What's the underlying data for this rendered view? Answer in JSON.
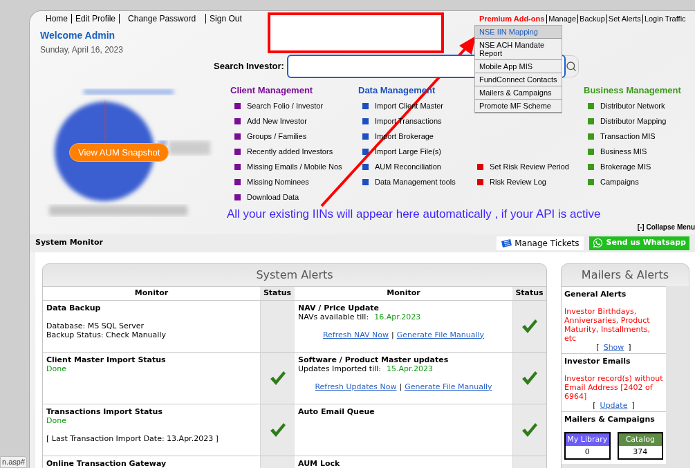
{
  "top_links": [
    "Home",
    "Edit Profile",
    "Change Password",
    "Sign Out"
  ],
  "admin_links": [
    {
      "label": "Premium Add-ons",
      "kind": "premium"
    },
    {
      "label": "Manage",
      "kind": "plain"
    },
    {
      "label": "Backup",
      "kind": "plain"
    },
    {
      "label": "Set Alerts",
      "kind": "plain"
    },
    {
      "label": "Login Traffic",
      "kind": "plain"
    }
  ],
  "premium_menu": [
    {
      "label": "NSE IIN Mapping",
      "selected": true
    },
    {
      "label": "NSE ACH Mandate Report",
      "selected": false
    },
    {
      "label": "Mobile App MIS",
      "selected": false
    },
    {
      "label": "FundConnect Contacts",
      "selected": false
    },
    {
      "label": "Mailers & Campaigns",
      "selected": false
    },
    {
      "label": "Promote MF Scheme",
      "selected": false
    }
  ],
  "welcome": "Welcome Admin",
  "date": "Sunday, April 16, 2023",
  "search": {
    "label": "Search Investor:"
  },
  "aum_button": "View AUM Snapshot",
  "menu_groups": [
    {
      "title": "Client Management",
      "color": "#7a0c96",
      "items": [
        "Search Folio / Investor",
        "Add New Investor",
        "Groups / Families",
        "Recently added Investors",
        "Missing Emails / Mobile Nos",
        "Missing Nominees",
        "Download Data"
      ]
    },
    {
      "title": "Data Management",
      "color": "#1a50c0",
      "items": [
        "Import Client Master",
        "Import Transactions",
        "Import Brokerage",
        "Import Large File(s)",
        "AUM Reconciliation",
        "Data Management tools"
      ]
    },
    {
      "color": "#e00000",
      "items": [
        "Set Risk Review Period",
        "Risk Review Log"
      ]
    },
    {
      "title": "Business Management",
      "color": "#3a9a1a",
      "items": [
        "Distributor Network",
        "Distributor Mapping",
        "Transaction MIS",
        "Business MIS",
        "Brokerage MIS",
        "Campaigns"
      ]
    }
  ],
  "annotation": {
    "text": "All your existing IINs will appear here automatically , if your API is active"
  },
  "collapse": "[-] Collapse Menu",
  "system_monitor": {
    "title": "System Monitor",
    "buttons": [
      {
        "label": "Manage Tickets",
        "kind": "tickets"
      },
      {
        "label": "Send us Whatsapp",
        "kind": "whatsapp"
      }
    ]
  },
  "system_alerts": {
    "title": "System Alerts",
    "columns": [
      "Monitor",
      "Status",
      "Monitor",
      "Status"
    ],
    "rows": [
      {
        "cells": [
          {
            "title": "Data Backup",
            "notes": [
              "Database: MS SQL Server",
              "Backup Status: Check Manually"
            ],
            "checked": false
          },
          {
            "title": "NAV / Price Update",
            "detail": {
              "label": "NAVs available till:",
              "value": "16.Apr.2023"
            },
            "links": [
              "Refresh NAV Now",
              "Generate File Manually"
            ],
            "separator": "|",
            "checked": true
          }
        ]
      },
      {
        "cells": [
          {
            "title": "Client Master Import Status",
            "status": "Done",
            "checked": true
          },
          {
            "title": "Software / Product Master updates",
            "detail": {
              "label": "Updates Imported till:",
              "value": "15.Apr.2023"
            },
            "links": [
              "Refresh Updates Now",
              "Generate File Manually"
            ],
            "separator": "|",
            "checked": true
          }
        ]
      },
      {
        "cells": [
          {
            "title": "Transactions Import Status",
            "status": "Done",
            "notes": [
              "[ Last Transaction Import Date: 13.Apr.2023 ]"
            ],
            "checked": true
          },
          {
            "title": "Auto Email Queue",
            "checked": true
          }
        ]
      },
      {
        "cells": [
          {
            "title": "Online Transaction Gateway",
            "checked": false
          },
          {
            "title": "AUM Lock",
            "checked": false
          }
        ]
      }
    ]
  },
  "mailers": {
    "title": "Mailers & Alerts",
    "sections": [
      {
        "title": "General Alerts",
        "message": "Investor Birthdays, Anniversaries, Product Maturity, Installments, etc",
        "link_open": "[",
        "link": "Show",
        "link_close": "]"
      },
      {
        "title": "Investor Emails",
        "message": "Investor record(s) without Email Address [2402 of 6964]",
        "link_open": "[",
        "link": "Update",
        "link_close": "]"
      },
      {
        "title": "Mailers & Campaigns",
        "tiles": [
          {
            "label": "My Library",
            "count": "0",
            "color": "#6b5cf6"
          },
          {
            "label": "Catalog",
            "count": "374",
            "color": "#5e8c45"
          }
        ]
      }
    ]
  },
  "status_bar": "n.asp#"
}
